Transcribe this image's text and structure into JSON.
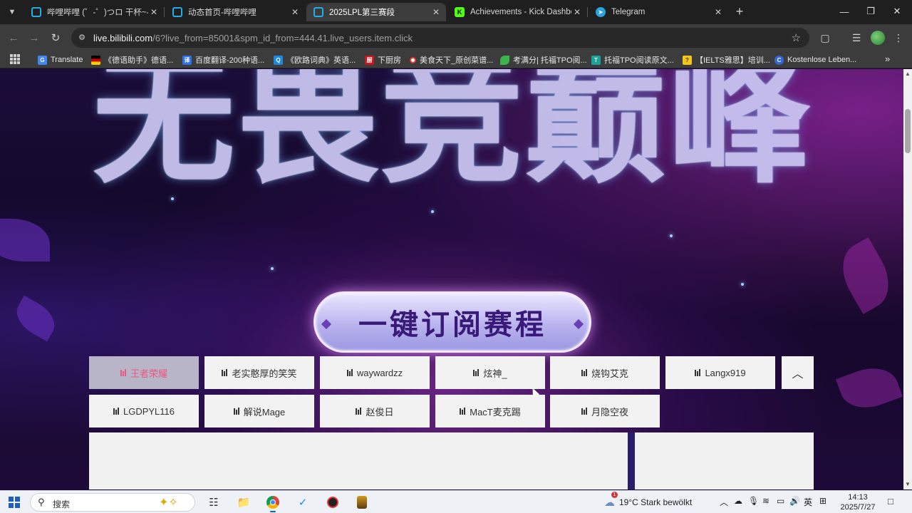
{
  "browser": {
    "tabs": [
      {
        "title": "哔哩哔哩 (゜-゜)つロ 干杯~-bili",
        "icon": "bilibili-icon",
        "color": "#23ade5",
        "active": false
      },
      {
        "title": "动态首页-哔哩哔哩",
        "icon": "bilibili-icon",
        "color": "#23ade5",
        "active": false
      },
      {
        "title": "2025LPL第三赛段",
        "icon": "bilibili-icon",
        "color": "#23ade5",
        "active": true
      },
      {
        "title": "Achievements - Kick Dashboard",
        "icon": "kick-icon",
        "color": "#53fc18",
        "active": false
      },
      {
        "title": "Telegram",
        "icon": "telegram-icon",
        "color": "#2aa3df",
        "active": false
      }
    ],
    "url": {
      "host": "live.bilibili.com",
      "path": "/6?live_from=85001&spm_id_from=444.41.live_users.item.click"
    },
    "bookmarks": [
      {
        "label": "Translate",
        "icon": "translate-icon",
        "color": "#4285f4"
      },
      {
        "label": "《德语助手》德语...",
        "icon": "flag-de-icon",
        "color": "#d00000"
      },
      {
        "label": "百度翻译-200种语...",
        "icon": "baidu-translate-icon",
        "color": "#2f6fec"
      },
      {
        "label": "《欧路词典》英语...",
        "icon": "eudic-icon",
        "color": "#1e88e5"
      },
      {
        "label": "下厨房",
        "icon": "xiachufang-icon",
        "color": "#c8161e"
      },
      {
        "label": "美食天下_原创菜谱...",
        "icon": "meishi-icon",
        "color": "#e53935"
      },
      {
        "label": "考满分| 托福TPO阅...",
        "icon": "kaomanfen-icon",
        "color": "#3bb54a"
      },
      {
        "label": "托福TPO阅读原文...",
        "icon": "tpo-icon",
        "color": "#1aa39a"
      },
      {
        "label": "【IELTS雅思】培训...",
        "icon": "ielts-icon",
        "color": "#f5c518"
      },
      {
        "label": "Kostenlose Leben...",
        "icon": "kostenlose-icon",
        "color": "#3367d6"
      }
    ]
  },
  "page": {
    "hero_title": "无畏竞巅峰",
    "subscribe_label": "一键订阅赛程",
    "streamers": [
      {
        "name": "王者荣耀",
        "active": true
      },
      {
        "name": "老实憨厚的笑笑",
        "active": false
      },
      {
        "name": "waywardzz",
        "active": false
      },
      {
        "name": "炫神_",
        "active": false
      },
      {
        "name": "烧钩艾克",
        "active": false
      },
      {
        "name": "Langx919",
        "active": false
      },
      {
        "name": "LGDPYL116",
        "active": false
      },
      {
        "name": "解说Mage",
        "active": false
      },
      {
        "name": "赵俊日",
        "active": false
      },
      {
        "name": "MacT麦克踢",
        "active": false
      },
      {
        "name": "月隐空夜",
        "active": false
      }
    ],
    "accent_color": "#e8597f"
  },
  "taskbar": {
    "search_placeholder": "搜索",
    "apps": [
      "task-view-icon",
      "file-explorer-icon",
      "chrome-icon",
      "snipaste-icon",
      "app-icon",
      "app2-icon"
    ],
    "weather": {
      "temp": "19°C",
      "desc": "Stark bewölkt",
      "badge": "1"
    },
    "ime": "英",
    "time": "14:13",
    "date": "2025/7/27"
  }
}
